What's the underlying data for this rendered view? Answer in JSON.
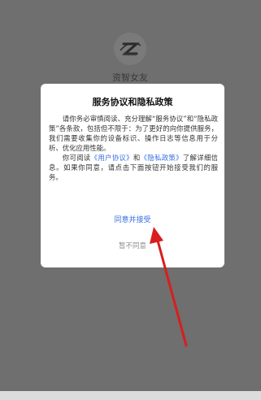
{
  "app": {
    "logo_caption": "资智女友",
    "name": "资智女友"
  },
  "dialog": {
    "title": "服务协议和隐私政策",
    "paragraph1": "请你务必审慎阅读、充分理解“服务协议”和“隐私政策”各条款，包括但不限于：为了更好的向你提供服务，我们需要收集你的设备标识、操作日志等信息用于分析、优化应用性能。",
    "p2_prefix": "你可阅读",
    "user_agreement_link": "《用户协议》",
    "p2_and": "和",
    "privacy_link": "《隐私政策》",
    "p2_suffix": "了解详细信息。如果你同意，请点击下面按钮开始接受我们的服务。",
    "agree_button": "同意并接受",
    "disagree_button": "暂不同意"
  },
  "colors": {
    "background": "#6f6f6f",
    "link": "#3a6fe0",
    "annotation_arrow": "#d81e1e"
  }
}
